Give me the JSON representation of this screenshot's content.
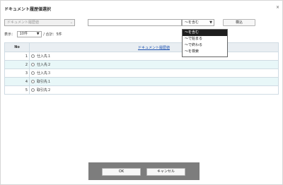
{
  "dialog": {
    "title": "ドキュメント履歴値選択",
    "close": "×"
  },
  "filter": {
    "attribute_select": "ドキュメント履歴値",
    "text_value": "",
    "condition_select": "～を含む",
    "search_button": "検込"
  },
  "display": {
    "prefix": "表示：",
    "per_page": "10件",
    "total": "/ 合計：5件"
  },
  "condition_options": [
    "～を含む",
    "～で始まる",
    "～で終わる",
    "～を検索"
  ],
  "table": {
    "col_no": "No",
    "col_doc": "ドキュメント履歴値",
    "rows": [
      {
        "no": "1",
        "value": "仕入先１"
      },
      {
        "no": "2",
        "value": "仕入先２"
      },
      {
        "no": "3",
        "value": "仕入先３"
      },
      {
        "no": "4",
        "value": "取引先１"
      },
      {
        "no": "5",
        "value": "取引先２"
      }
    ]
  },
  "footer": {
    "ok": "OK",
    "cancel": "キャンセル"
  }
}
